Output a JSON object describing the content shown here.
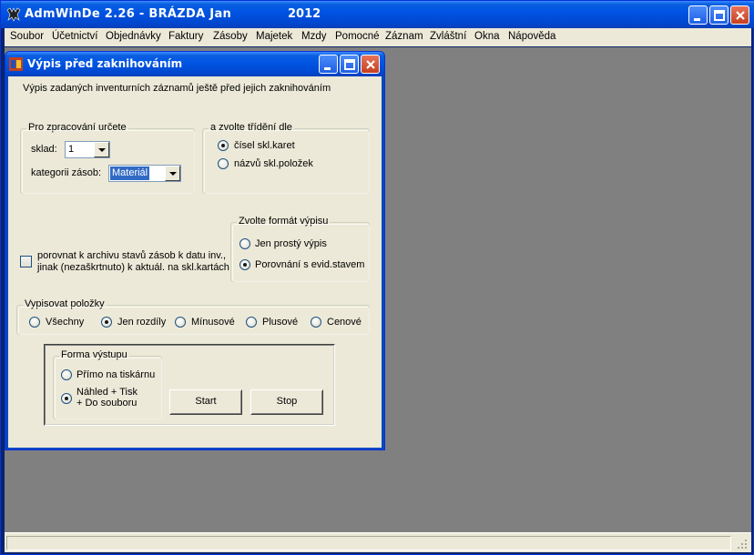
{
  "main_window": {
    "title": "AdmWinDe 2.26 - BRÁZDA Jan",
    "year": "2012",
    "icon": "admwinde-app-icon"
  },
  "menu": [
    {
      "label": "Soubor"
    },
    {
      "label": "Účetnictví"
    },
    {
      "label": "Objednávky"
    },
    {
      "label": "Faktury"
    },
    {
      "label": "Zásoby"
    },
    {
      "label": "Majetek"
    },
    {
      "label": "Mzdy"
    },
    {
      "label": "Pomocné"
    },
    {
      "label": "Záznam"
    },
    {
      "label": "Zvláštní"
    },
    {
      "label": "Okna"
    },
    {
      "label": "Nápověda"
    }
  ],
  "dialog": {
    "title": "Výpis před zaknihováním",
    "description": "Výpis zadaných inventurních záznamů ještě před jejich zaknihováním",
    "processing_group": {
      "title": "Pro zpracování určete",
      "sklad_label": "sklad:",
      "sklad_value": "1",
      "kategorie_label": "kategorii zásob:",
      "kategorie_value": "Materiál"
    },
    "sort_group": {
      "title": "a zvolte třídění dle",
      "option_1": "čísel skl.karet",
      "option_2": "názvů skl.položek",
      "selected": "option_1"
    },
    "compare_checkbox": {
      "line_1": "porovnat k archivu stavů zásob k datu inv.,",
      "line_2": "jinak (nezaškrtnuto) k aktuál. na skl.kartách",
      "checked": false
    },
    "format_group": {
      "title": "Zvolte formát výpisu",
      "option_1": "Jen prostý výpis",
      "option_2": "Porovnání s evid.stavem",
      "selected": "option_2"
    },
    "items_group": {
      "title": "Vypisovat položky",
      "options": [
        "Všechny",
        "Jen rozdíly",
        "Mínusové",
        "Plusové",
        "Cenové"
      ],
      "selected": "Jen rozdíly"
    },
    "output_group": {
      "title": "Forma výstupu",
      "option_1": "Přímo na tiskárnu",
      "option_2_line_1": "Náhled + Tisk",
      "option_2_line_2": "+ Do souboru",
      "selected": "option_2"
    },
    "start_label": "Start",
    "stop_label": "Stop"
  },
  "colors": {
    "titlebar": "#0054e3",
    "mdi_background": "#808080",
    "dialog_background": "#ece9d8",
    "selection": "#316ac5"
  }
}
